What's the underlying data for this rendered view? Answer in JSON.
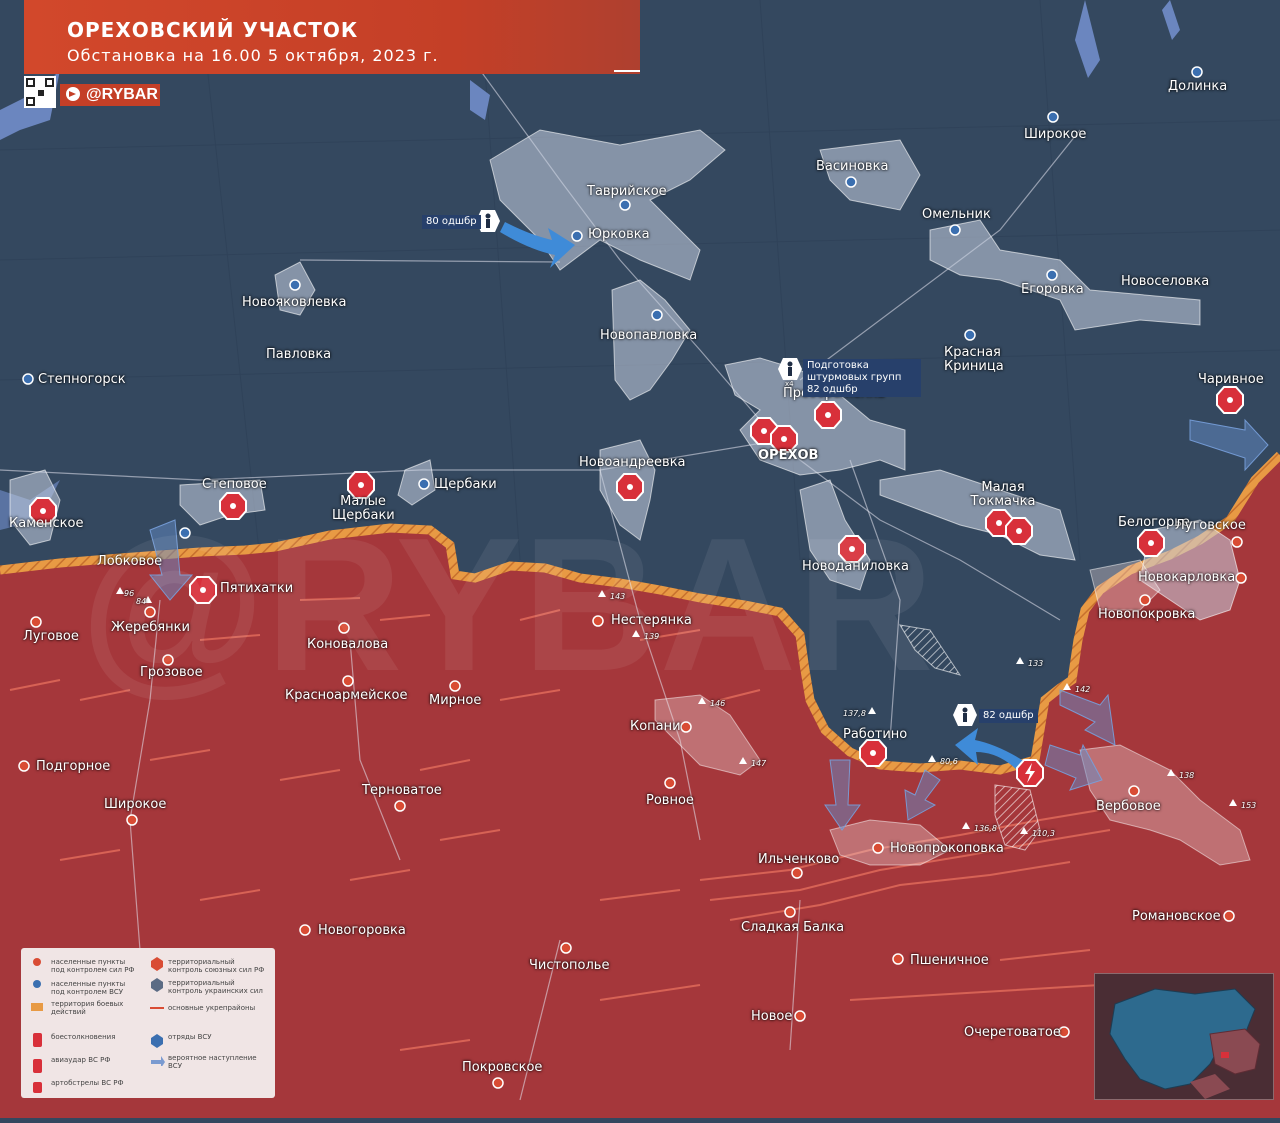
{
  "header": {
    "title": "ОРЕХОВСКИЙ УЧАСТОК",
    "subtitle": "Обстановка на 16.00 5 октября, 2023 г.",
    "brand": "@RYBAR"
  },
  "colors": {
    "ua_territory": "#33475f",
    "ru_territory": "#a6373a",
    "front_line": "#e8a049",
    "header_bg": "#c43f27",
    "ua_marker": "#3b6fb0",
    "ru_marker": "#d2482b"
  },
  "ua_settlements": [
    {
      "name": "Долинка"
    },
    {
      "name": "Широкое"
    },
    {
      "name": "Васиновка"
    },
    {
      "name": "Таврийское"
    },
    {
      "name": "Юрковка"
    },
    {
      "name": "Омельник"
    },
    {
      "name": "Новоселовка"
    },
    {
      "name": "Егоровка"
    },
    {
      "name": "Новояковлевка"
    },
    {
      "name": "Новопавловка"
    },
    {
      "name": "Павловка"
    },
    {
      "name": "Красная Криница"
    },
    {
      "name": "Степногорск"
    },
    {
      "name": "Преображенка"
    },
    {
      "name": "ОРЕХОВ"
    },
    {
      "name": "Новоандреевка"
    },
    {
      "name": "Щербаки"
    },
    {
      "name": "Малые Щербаки"
    },
    {
      "name": "Степовое"
    },
    {
      "name": "Малая Токмачка"
    },
    {
      "name": "Чаривное"
    },
    {
      "name": "Каменское"
    },
    {
      "name": "Лобковое"
    },
    {
      "name": "Новоданиловка"
    },
    {
      "name": "Белогорье"
    }
  ],
  "ru_settlements": [
    {
      "name": "Луговское"
    },
    {
      "name": "Новокарловка"
    },
    {
      "name": "Новопокровка"
    },
    {
      "name": "Пятихатки"
    },
    {
      "name": "Луговое"
    },
    {
      "name": "Жеребянки"
    },
    {
      "name": "Нестерянка"
    },
    {
      "name": "Коновалова"
    },
    {
      "name": "Грозовое"
    },
    {
      "name": "Красноармейское"
    },
    {
      "name": "Мирное"
    },
    {
      "name": "Копани"
    },
    {
      "name": "Работино"
    },
    {
      "name": "Подгорное"
    },
    {
      "name": "Терноватое"
    },
    {
      "name": "Ровное"
    },
    {
      "name": "Вербовое"
    },
    {
      "name": "Широкое"
    },
    {
      "name": "Новопрокоповка"
    },
    {
      "name": "Ильченково"
    },
    {
      "name": "Сладкая Балка"
    },
    {
      "name": "Романовское"
    },
    {
      "name": "Новогоровка"
    },
    {
      "name": "Чистополье"
    },
    {
      "name": "Пшеничное"
    },
    {
      "name": "Новое"
    },
    {
      "name": "Очеретоватое"
    },
    {
      "name": "Покровское"
    }
  ],
  "heights": [
    "96",
    "84",
    "143",
    "139",
    "146",
    "147",
    "133",
    "142",
    "137,8",
    "80,6",
    "136,8",
    "110,3",
    "138",
    "153"
  ],
  "units": [
    {
      "label": "80 одшбр"
    },
    {
      "label": "Подготовка штурмовых групп 82 одшбр",
      "multiplier": "x4"
    },
    {
      "label": "82 одшбр"
    }
  ],
  "legend": {
    "items": [
      "населенные пункты под контролем сил РФ",
      "населенные пункты под контролем ВСУ",
      "территория боевых действий",
      "территориальный контроль союзных сил РФ",
      "территориальный контроль украинских сил",
      "основные укрепрайоны",
      "боестолкновения",
      "отряды ВСУ",
      "авиаудар ВС РФ",
      "вероятное наступление ВСУ",
      "артобстрелы ВС РФ"
    ]
  },
  "watermark": "@RYBAR"
}
